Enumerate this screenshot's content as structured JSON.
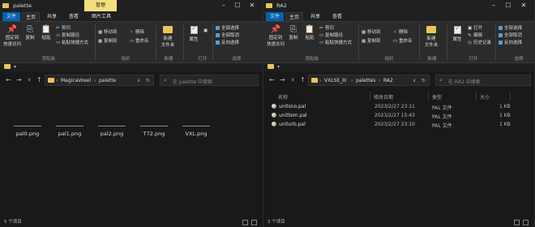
{
  "left": {
    "title": "palette",
    "manage_tab": "管理",
    "tabs": [
      "文件",
      "主页",
      "共享",
      "查看",
      "图片工具"
    ],
    "ribbon": {
      "pin": "固定到\n快速访问",
      "copy": "复制",
      "paste": "粘贴",
      "cut": "剪切",
      "copy_path": "复制路径",
      "paste_shortcut": "粘贴快捷方式",
      "clipboard_label": "剪贴板",
      "move_to": "移动到",
      "copy_to": "复制到",
      "delete": "删除",
      "rename": "重命名",
      "organize_label": "组织",
      "new_folder": "新建\n文件夹",
      "new_label": "新建",
      "properties": "属性",
      "open_label": "打开",
      "select_all": "全部选择",
      "select_none": "全部取消",
      "invert_select": "反向选择",
      "select_label": "选择"
    },
    "breadcrumb": [
      "MagicaVoxel",
      "palette"
    ],
    "search_placeholder": "在 palette 中搜索",
    "files": [
      "pal0.png",
      "pal1.png",
      "pal2.png",
      "T72.png",
      "VXL.png"
    ],
    "status": "5 个项目"
  },
  "right": {
    "title": "RA2",
    "tabs": [
      "文件",
      "主页",
      "共享",
      "查看"
    ],
    "ribbon": {
      "pin": "固定到\n快速访问",
      "copy": "复制",
      "paste": "粘贴",
      "cut": "剪切",
      "copy_path": "复制路径",
      "paste_shortcut": "粘贴快捷方式",
      "clipboard_label": "剪贴板",
      "move_to": "移动到",
      "copy_to": "复制到",
      "delete": "删除",
      "rename": "重命名",
      "organize_label": "组织",
      "new_folder": "新建\n文件夹",
      "new_label": "新建",
      "properties": "属性",
      "open": "打开",
      "edit": "编辑",
      "history": "历史记录",
      "open_label": "打开",
      "select_all": "全部选择",
      "select_none": "全部取消",
      "invert_select": "反向选择",
      "select_label": "选择"
    },
    "breadcrumb": [
      "VXLSE_III",
      "palettes",
      "RA2"
    ],
    "search_placeholder": "在 RA2 中搜索",
    "columns": [
      "名称",
      "修改日期",
      "类型",
      "大小"
    ],
    "files": [
      {
        "name": "unitsno.pal",
        "date": "2023/2/27 23:11",
        "type": "PAL 文件",
        "size": "1 KB"
      },
      {
        "name": "unittem.pal",
        "date": "2023/2/27 15:43",
        "type": "PAL 文件",
        "size": "1 KB"
      },
      {
        "name": "uniturb.pal",
        "date": "2023/2/27 23:10",
        "type": "PAL 文件",
        "size": "1 KB"
      }
    ],
    "status": "3 个项目"
  },
  "colors": {
    "manage_tab": "#f3e07b",
    "folder": "#e8c45a",
    "background": "#191919",
    "ribbon": "#2b2b2b"
  }
}
